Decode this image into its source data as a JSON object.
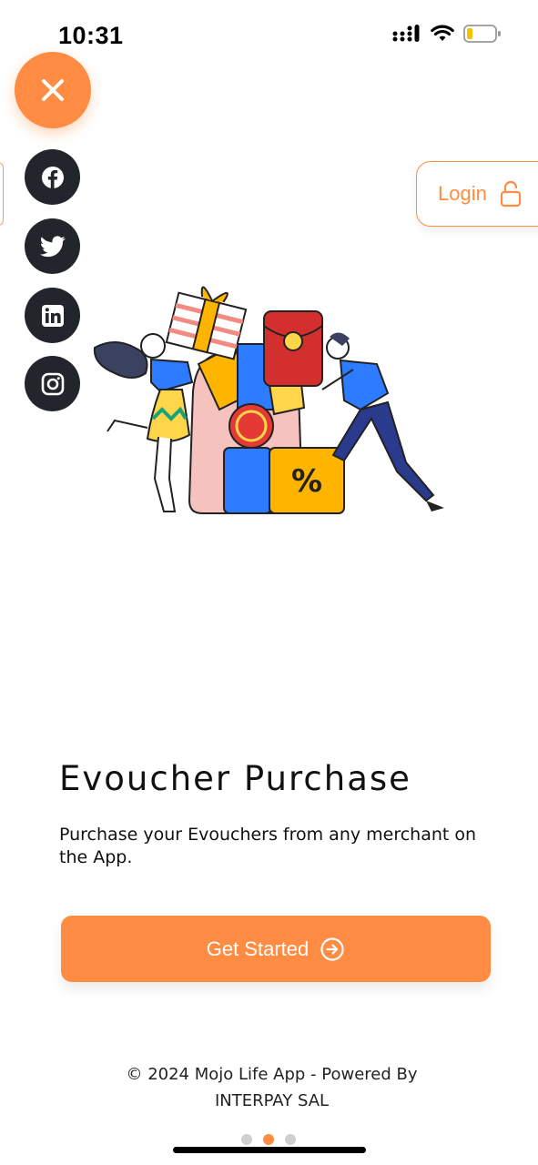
{
  "status_bar": {
    "time": "10:31"
  },
  "header": {
    "login_label": "Login"
  },
  "social_links": [
    {
      "name": "facebook-icon"
    },
    {
      "name": "twitter-icon"
    },
    {
      "name": "linkedin-icon"
    },
    {
      "name": "instagram-icon"
    }
  ],
  "onboarding": {
    "title": "Evoucher Purchase",
    "description": "Purchase your Evouchers from any merchant on the App.",
    "illustration_text": "%",
    "cta_label": "Get Started",
    "page_index": 2,
    "page_count": 3
  },
  "footer": {
    "line1": "© 2024 Mojo Life App - Powered By",
    "line2": "INTERPAY SAL"
  },
  "colors": {
    "accent": "#ff8c42",
    "social_bg": "#22252b"
  }
}
